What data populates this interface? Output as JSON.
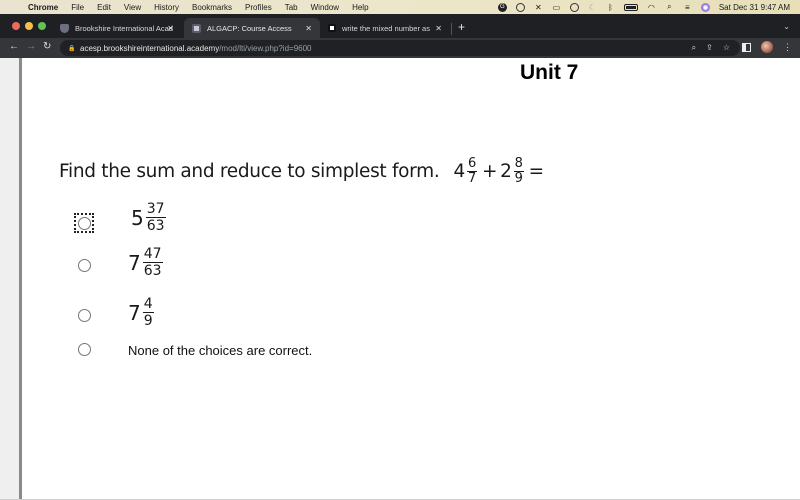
{
  "menubar": {
    "app_name": "Chrome",
    "items": [
      "File",
      "Edit",
      "View",
      "History",
      "Bookmarks",
      "Profiles",
      "Tab",
      "Window",
      "Help"
    ],
    "clock": "Sat Dec 31  9:47 AM"
  },
  "tabs": [
    {
      "title": "Brookshire International Acade",
      "active": false
    },
    {
      "title": "ALGACP: Course Access",
      "active": true
    },
    {
      "title": "write the mixed number as an i",
      "active": false
    }
  ],
  "toolbar": {
    "url_host": "acesp.brookshireinternational.academy",
    "url_path": "/mod/lti/view.php?id=9600"
  },
  "page": {
    "unit_title": "Unit 7",
    "question": {
      "prompt": "Find the sum and reduce to simplest form.",
      "term1": {
        "whole": "4",
        "num": "6",
        "den": "7"
      },
      "operator": "+",
      "term2": {
        "whole": "2",
        "num": "8",
        "den": "9"
      },
      "equals": "="
    },
    "choices": [
      {
        "whole": "5",
        "num": "37",
        "den": "63",
        "focused": true
      },
      {
        "whole": "7",
        "num": "47",
        "den": "63",
        "focused": false
      },
      {
        "whole": "7",
        "num": "4",
        "den": "9",
        "focused": false
      },
      {
        "text": "None of the choices are correct.",
        "focused": false
      }
    ]
  }
}
